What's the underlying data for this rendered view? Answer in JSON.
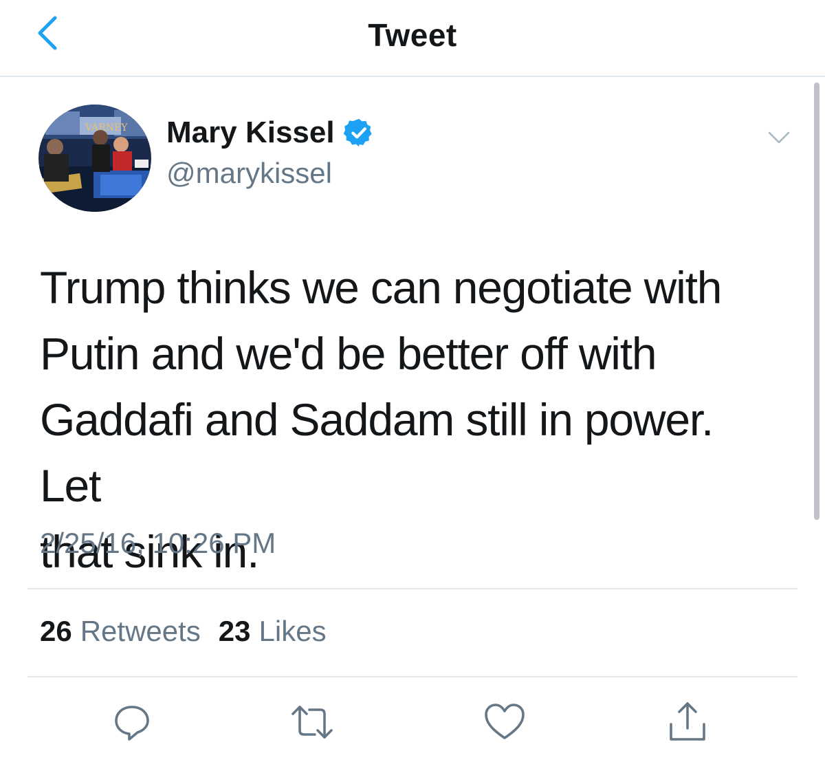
{
  "header": {
    "title": "Tweet",
    "back_icon": "chevron-left-icon",
    "accent_color": "#1da1f2"
  },
  "author": {
    "name": "Mary Kissel",
    "handle": "@marykissel",
    "verified": true,
    "avatar_sign_text": "VARNEY"
  },
  "tweet": {
    "lines": [
      "Trump thinks we can negotiate with",
      "Putin and we'd be better off with",
      "Gaddafi and Saddam still in power. Let",
      "that sink in."
    ],
    "timestamp": "2/25/16, 10:26 PM"
  },
  "stats": {
    "retweets_count": "26",
    "retweets_label": "Retweets",
    "likes_count": "23",
    "likes_label": "Likes"
  },
  "actions": {
    "reply_icon": "reply-icon",
    "retweet_icon": "retweet-icon",
    "like_icon": "heart-icon",
    "share_icon": "share-icon"
  },
  "colors": {
    "text_primary": "#14171a",
    "text_secondary": "#657786",
    "divider": "#e1e8ed",
    "verified_blue": "#1da1f2"
  }
}
